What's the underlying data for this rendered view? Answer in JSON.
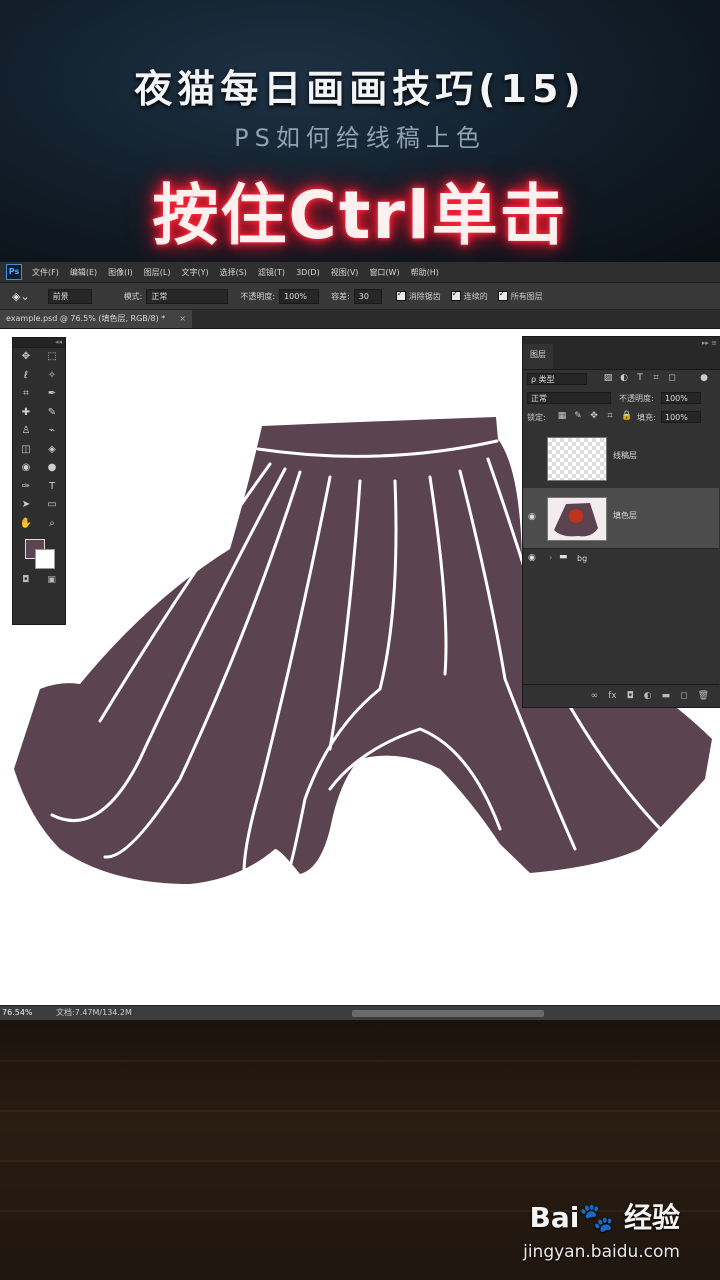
{
  "banner": {
    "title": "夜猫每日画画技巧(15)",
    "subtitle": "PS如何给线稿上色",
    "headline": "按住Ctrl单击"
  },
  "menubar": {
    "logo": "Ps",
    "items": [
      "文件(F)",
      "编辑(E)",
      "图像(I)",
      "图层(L)",
      "文字(Y)",
      "选择(S)",
      "滤镜(T)",
      "3D(D)",
      "视图(V)",
      "窗口(W)",
      "帮助(H)"
    ]
  },
  "options": {
    "fill_source": "前景",
    "mode_label": "模式:",
    "mode_value": "正常",
    "opacity_label": "不透明度:",
    "opacity_value": "100%",
    "tolerance_label": "容差:",
    "tolerance_value": "30",
    "antialias": "消除锯齿",
    "contiguous": "连续的",
    "all_layers": "所有图层"
  },
  "document": {
    "tab_title": "example.psd @ 76.5% (填色层, RGB/8) *",
    "close": "×"
  },
  "status": {
    "zoom": "76.54%",
    "doc_size": "文档:7.47M/134.2M"
  },
  "tools": {
    "grip": "◂◂",
    "icons": [
      [
        "✥",
        "⬚"
      ],
      [
        "ℓ",
        "✧"
      ],
      [
        "⌗",
        "✒"
      ],
      [
        "✚",
        "✎"
      ],
      [
        "♙",
        "⌁"
      ],
      [
        "◫",
        "◈"
      ],
      [
        "◉",
        "●"
      ],
      [
        "✑",
        "T"
      ],
      [
        "➤",
        "▭"
      ],
      [
        "✋",
        "⌕"
      ]
    ]
  },
  "layers_panel": {
    "tab": "图层",
    "menu": "▸▸ ≡",
    "filter_label": "ρ 类型",
    "blend_mode": "正常",
    "opacity_label": "不透明度:",
    "opacity_value": "100%",
    "lock_label": "锁定:",
    "fill_label": "填充:",
    "fill_value": "100%",
    "layers": [
      {
        "name": "线稿层",
        "visible": false
      },
      {
        "name": "填色层",
        "visible": true,
        "active": true
      }
    ],
    "group_name": "bg",
    "footer_icons": [
      "∞",
      "fx",
      "◘",
      "◐",
      "▬",
      "◻",
      "🗑"
    ]
  },
  "skirt": {
    "fill_color": "#5b4450",
    "line_color": "#ffffff"
  },
  "watermark": {
    "logo": "Bai🐾 经验",
    "url": "jingyan.baidu.com"
  }
}
